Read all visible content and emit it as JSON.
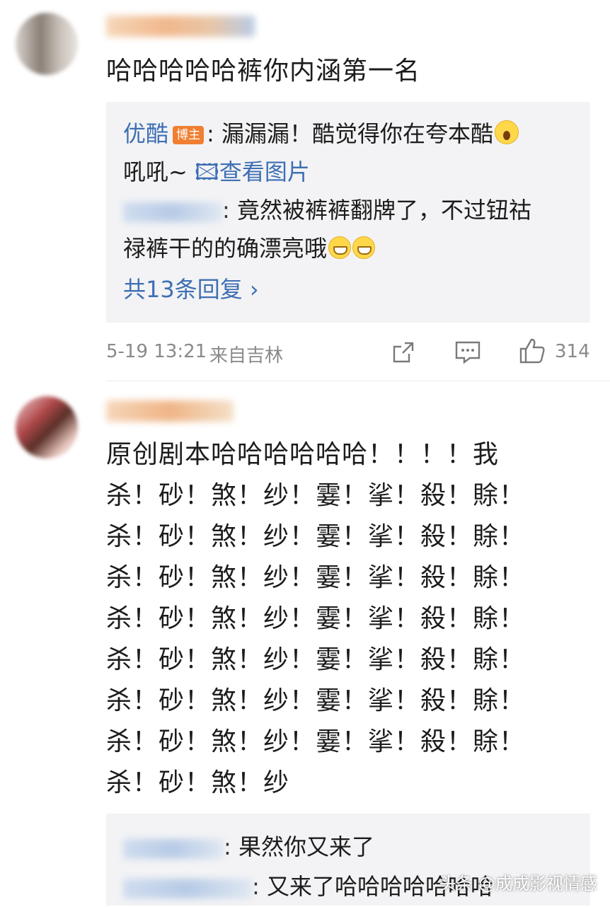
{
  "comment1": {
    "text": "哈哈哈哈哈裤你内涵第一名",
    "reply_thread": {
      "reply1_author": "优酷",
      "reply1_badge": "博主",
      "reply1_line1": ": 漏漏漏！酷觉得你在夸本酷",
      "reply1_line2_start": "吼吼~ ",
      "reply1_link": "🖾查看图片",
      "reply2_line1": ": 竟然被裤裤翻牌了，不过钮祜",
      "reply2_line2": "禄裤干的的确漂亮哦",
      "more_replies": "共13条回复 ›"
    },
    "timestamp": "5-19 13:21",
    "location": "来自吉林",
    "like_count": "314"
  },
  "comment2": {
    "lines": [
      "原创剧本哈哈哈哈哈哈！！！！我",
      "杀！砂！煞！纱！霎！挲！殺！賖！",
      "杀！砂！煞！纱！霎！挲！殺！賖！",
      "杀！砂！煞！纱！霎！挲！殺！賖！",
      "杀！砂！煞！纱！霎！挲！殺！賖！",
      "杀！砂！煞！纱！霎！挲！殺！賖！",
      "杀！砂！煞！纱！霎！挲！殺！賖！",
      "杀！砂！煞！纱！霎！挲！殺！賖！",
      "杀！砂！煞！纱"
    ],
    "reply_thread": {
      "reply1_text": ": 果然你又来了",
      "reply2_text": ": 又来了哈哈哈哈哈哈哈"
    }
  },
  "watermark": "头条 @成成影视情感",
  "icons": {
    "forward": "share-icon",
    "comment": "comment-icon",
    "like": "thumbs-up-icon"
  },
  "colors": {
    "link_blue": "#3e6fb3",
    "badge_orange": "#f07f31",
    "reply_bg": "#f3f3f5",
    "meta_gray": "#8a8a8a"
  }
}
